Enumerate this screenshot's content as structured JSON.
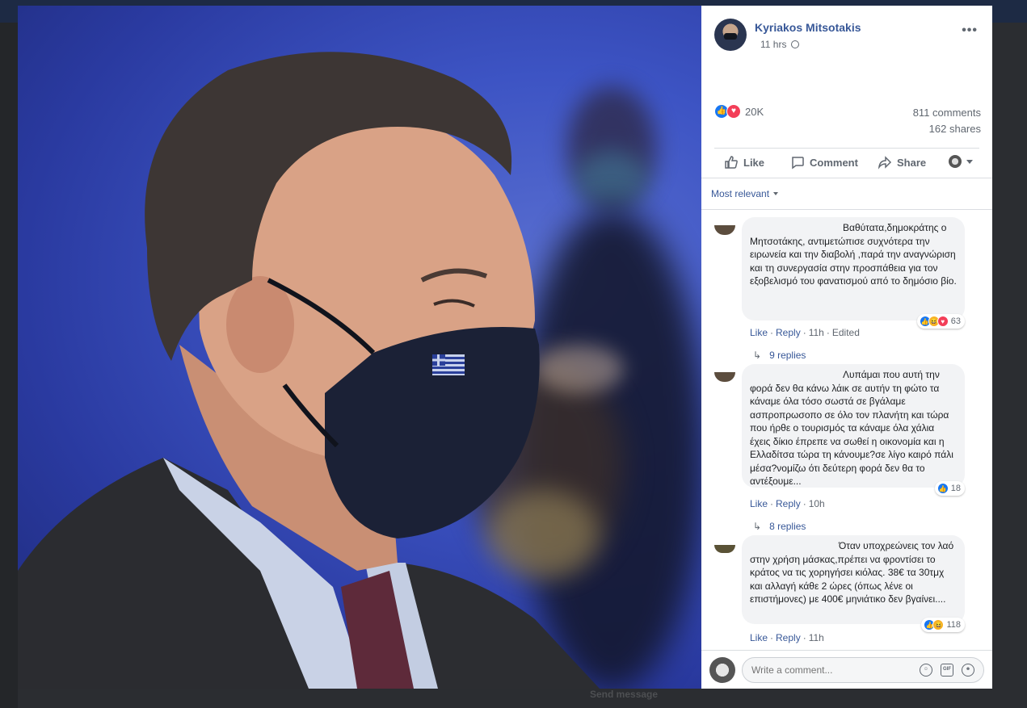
{
  "background": {
    "footer_text": "Send message"
  },
  "post": {
    "author": "Kyriakos Mitsotakis",
    "time": "11 hrs",
    "reaction_count": "20K",
    "comments_count": "811 comments",
    "shares_count": "162 shares",
    "actions": {
      "like": "Like",
      "comment": "Comment",
      "share": "Share"
    },
    "sort_label": "Most relevant"
  },
  "comments": [
    {
      "text": "Βαθύτατα,δημοκράτης ο Μητσοτάκης, αντιμετώπισε συχνότερα την ειρωνεία και την διαβολή ,παρά την αναγνώριση και τη συνεργασία στην προσπάθεια για τον εξοβελισμό του φανατισμού από το δημόσιο βίο.",
      "reactions": [
        "like",
        "haha",
        "love"
      ],
      "reaction_count": "63",
      "like": "Like",
      "reply": "Reply",
      "time": "11h",
      "edited": "Edited",
      "replies": "9 replies"
    },
    {
      "text": "Λυπάμαι που αυτή την φορά δεν θα κάνω λάικ σε αυτήν τη φώτο τα κάναμε όλα τόσο σωστά σε βγάλαμε ασπροπρωσοπο σε όλο τον πλανήτη και τώρα που ήρθε ο τουρισμός τα κάναμε όλα χάλια έχεις δίκιο έπρεπε να σωθεί η οικονομία και η Ελλαδίτσα τώρα τη κάνουμε?σε λίγο καιρό πάλι μέσα?νομίζω ότι δεύτερη φορά δεν θα το αντέξουμε...",
      "reactions": [
        "like"
      ],
      "reaction_count": "18",
      "like": "Like",
      "reply": "Reply",
      "time": "10h",
      "replies": "8 replies"
    },
    {
      "text": "Όταν υποχρεώνεις τον λαό στην χρήση μάσκας,πρέπει να φροντίσει το κράτος να τις χορηγήσει κιόλας. 38€ τα 30τμχ και αλλαγή κάθε 2 ώρες (όπως λένε οι επιστήμονες) με 400€ μηνιάτικο δεν βγαίνει....",
      "reactions": [
        "like",
        "haha"
      ],
      "reaction_count": "118",
      "like": "Like",
      "reply": "Reply",
      "time": "11h"
    }
  ],
  "composer": {
    "placeholder": "Write a comment..."
  },
  "colors": {
    "link": "#385898",
    "like_blue": "#1877f2",
    "love_red": "#f33e58",
    "haha_yellow": "#f7b125"
  }
}
